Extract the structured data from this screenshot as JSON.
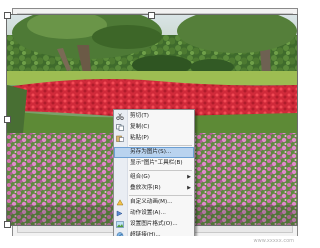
{
  "context_menu": {
    "items": [
      {
        "label": "剪切(T)",
        "icon": "scissors-icon"
      },
      {
        "label": "复制(C)",
        "icon": "copy-icon"
      },
      {
        "label": "粘贴(P)",
        "icon": "paste-icon"
      },
      {
        "label": "另存为图片(S)...",
        "icon": "",
        "highlighted": true
      },
      {
        "label": "显示\"图片\"工具栏(B)",
        "icon": ""
      },
      {
        "label": "组合(G)",
        "icon": "",
        "submenu": true
      },
      {
        "label": "叠放次序(R)",
        "icon": "",
        "submenu": true
      },
      {
        "label": "自定义动画(M)...",
        "icon": "animation-icon"
      },
      {
        "label": "动作设置(A)...",
        "icon": "action-icon"
      },
      {
        "label": "设置图片格式(O)...",
        "icon": "format-picture-icon"
      },
      {
        "label": "超链接(H)...",
        "icon": "hyperlink-icon"
      }
    ]
  },
  "colors": {
    "menu_highlight": "#b9d3ef",
    "menu_bg": "#f7f7f7"
  },
  "watermark": "www.xxxxx.com"
}
